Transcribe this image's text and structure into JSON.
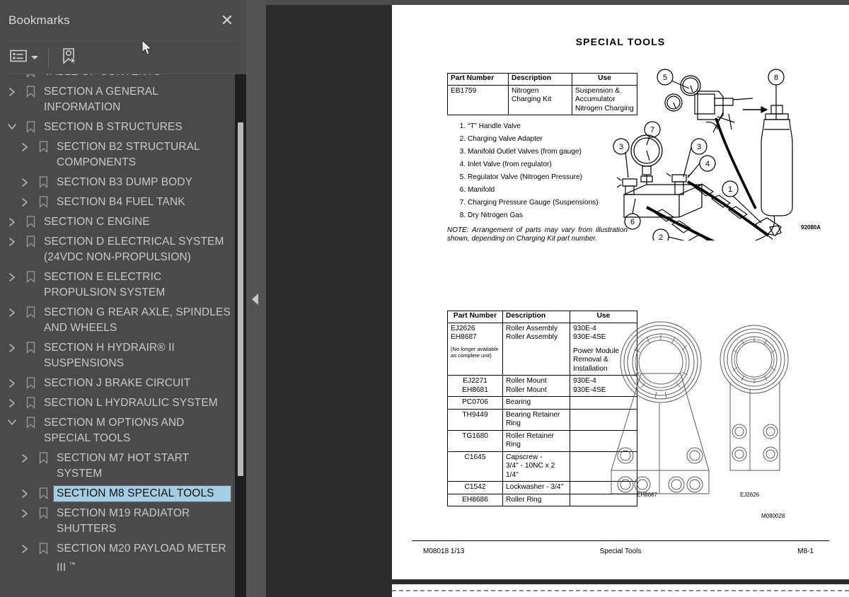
{
  "panel": {
    "title": "Bookmarks",
    "close_label": "✕",
    "toolbar": {
      "options_icon": "list-options-icon",
      "new_bookmark_icon": "new-bookmark-icon"
    }
  },
  "bookmarks": [
    {
      "label": "TABLE OF CONTENTS",
      "level": 1,
      "twisty": "none",
      "selected": false,
      "clipped": true
    },
    {
      "label": "SECTION A GENERAL INFORMATION",
      "level": 1,
      "twisty": "collapsed",
      "selected": false
    },
    {
      "label": "SECTION B STRUCTURES",
      "level": 1,
      "twisty": "expanded",
      "selected": false
    },
    {
      "label": "SECTION B2 STRUCTURAL COMPONENTS",
      "level": 2,
      "twisty": "collapsed",
      "selected": false
    },
    {
      "label": "SECTION B3 DUMP BODY",
      "level": 2,
      "twisty": "collapsed",
      "selected": false
    },
    {
      "label": "SECTION B4 FUEL TANK",
      "level": 2,
      "twisty": "collapsed",
      "selected": false
    },
    {
      "label": "SECTION C ENGINE",
      "level": 1,
      "twisty": "collapsed",
      "selected": false
    },
    {
      "label": "SECTION D ELECTRICAL SYSTEM (24VDC NON-PROPULSION)",
      "level": 1,
      "twisty": "collapsed",
      "selected": false
    },
    {
      "label": "SECTION E ELECTRIC PROPULSION SYSTEM",
      "level": 1,
      "twisty": "collapsed",
      "selected": false
    },
    {
      "label": "SECTION G REAR AXLE, SPINDLES AND WHEELS",
      "level": 1,
      "twisty": "collapsed",
      "selected": false
    },
    {
      "label": "SECTION H HYDRAIR® II SUSPENSIONS",
      "level": 1,
      "twisty": "collapsed",
      "selected": false
    },
    {
      "label": "SECTION J BRAKE CIRCUIT",
      "level": 1,
      "twisty": "collapsed",
      "selected": false
    },
    {
      "label": "SECTION L HYDRAULIC SYSTEM",
      "level": 1,
      "twisty": "collapsed",
      "selected": false
    },
    {
      "label": "SECTION M OPTIONS AND SPECIAL TOOLS",
      "level": 1,
      "twisty": "expanded",
      "selected": false
    },
    {
      "label": "SECTION M7 HOT START SYSTEM",
      "level": 2,
      "twisty": "collapsed",
      "selected": false
    },
    {
      "label": "SECTION M8 SPECIAL TOOLS",
      "level": 2,
      "twisty": "collapsed",
      "selected": true
    },
    {
      "label": "SECTION M19 RADIATOR SHUTTERS",
      "level": 2,
      "twisty": "collapsed",
      "selected": false
    },
    {
      "label": "SECTION M20 PAYLOAD METER III ™",
      "level": 2,
      "twisty": "collapsed",
      "selected": false
    }
  ],
  "document": {
    "title": "SPECIAL TOOLS",
    "table1": {
      "headers": [
        "Part Number",
        "Description",
        "Use"
      ],
      "rows": [
        [
          "EB1759",
          "Nitrogen\nCharging Kit",
          "Suspension &\nAccumulator\nNitrogen Charging"
        ]
      ]
    },
    "callout_items": [
      "“T” Handle Valve",
      "Charging Valve Adapter",
      "Manifold Outlet Valves (from gauge)",
      "Inlet Valve (from regulator)",
      "Regulator Valve (Nitrogen Pressure)",
      "Manifold",
      "Charging Pressure Gauge (Suspensions)",
      "Dry Nitrogen Gas"
    ],
    "note": "NOTE: Arrangement of parts may vary from illustration shown, depending on Charging Kit part number.",
    "figure1_id": "92080A",
    "table2": {
      "headers": [
        "Part Number",
        "Description",
        "Use"
      ],
      "rows": [
        {
          "part": "EJ2626\nEH8687",
          "part_small": "(No longer available as complete unit)",
          "desc": "Roller Assembly\nRoller Assembly",
          "use": "930E-4\n930E-4SE\n\nPower Module\nRemoval &\nInstallation",
          "center": false
        },
        {
          "part": "EJ2271\nEH8681",
          "desc": "Roller Mount\nRoller Mount",
          "use": "930E-4\n930E-4SE",
          "center": true
        },
        {
          "part": "PC0706",
          "desc": "Bearing",
          "use": "",
          "center": true
        },
        {
          "part": "TH9449",
          "desc": "Bearing Retainer\nRing",
          "use": "",
          "center": true
        },
        {
          "part": "TG1680",
          "desc": "Roller Retainer\nRing",
          "use": "",
          "center": true
        },
        {
          "part": "C1645",
          "desc": "Capscrew -\n3/4\" - 10NC x 2 1/4\"",
          "use": "",
          "center": true
        },
        {
          "part": "C1542",
          "desc": "Lockwasher - 3/4\"",
          "use": "",
          "center": true
        },
        {
          "part": "EH8686",
          "desc": "Roller Ring",
          "use": "",
          "center": true
        }
      ]
    },
    "figure2_labels": {
      "left": "EH8687",
      "right": "EJ2626",
      "id": "M080028"
    },
    "footer": {
      "left": "M08018  1/13",
      "center": "Special Tools",
      "right": "M8-1"
    }
  },
  "colors": {
    "panel_bg": "#4a4a4a",
    "viewport_bg": "#2b2b2b",
    "selection": "#a4cde3",
    "text": "#c9c9c9",
    "page": "#ffffff"
  }
}
